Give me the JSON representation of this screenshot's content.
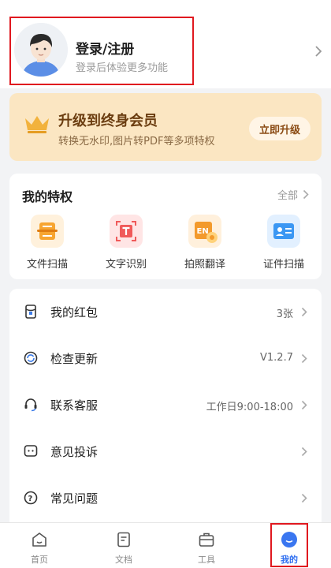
{
  "profile": {
    "title": "登录/注册",
    "subtitle": "登录后体验更多功能",
    "avatar_icon": "user-avatar-icon"
  },
  "vip": {
    "title": "升级到终身会员",
    "subtitle": "转换无水印,图片转PDF等多项特权",
    "button": "立即升级",
    "colors": {
      "card": "#fbe6c2",
      "title": "#6b3d10",
      "crown": "#f2b23c"
    }
  },
  "privileges": {
    "title": "我的特权",
    "all_label": "全部",
    "items": [
      {
        "label": "文件扫描",
        "icon": "document-scan-icon",
        "color": "#f7a531"
      },
      {
        "label": "文字识别",
        "icon": "text-recognition-icon",
        "color": "#f05a5a"
      },
      {
        "label": "拍照翻译",
        "icon": "photo-translate-icon",
        "color": "#f39a2c"
      },
      {
        "label": "证件扫描",
        "icon": "id-card-scan-icon",
        "color": "#3b97f3"
      }
    ]
  },
  "menu": {
    "items": [
      {
        "label": "我的红包",
        "value": "3张",
        "icon": "red-packet-icon"
      },
      {
        "label": "检查更新",
        "value": "V1.2.7",
        "icon": "refresh-icon"
      },
      {
        "label": "联系客服",
        "value": "工作日9:00-18:00",
        "icon": "headset-icon"
      },
      {
        "label": "意见投诉",
        "value": "",
        "icon": "feedback-icon"
      },
      {
        "label": "常见问题",
        "value": "",
        "icon": "help-icon"
      }
    ]
  },
  "tabbar": {
    "tabs": [
      {
        "label": "首页",
        "icon": "home-icon"
      },
      {
        "label": "文档",
        "icon": "document-icon"
      },
      {
        "label": "工具",
        "icon": "toolbox-icon"
      },
      {
        "label": "我的",
        "icon": "profile-icon",
        "active": true
      }
    ],
    "active_color": "#2f6ff0"
  }
}
